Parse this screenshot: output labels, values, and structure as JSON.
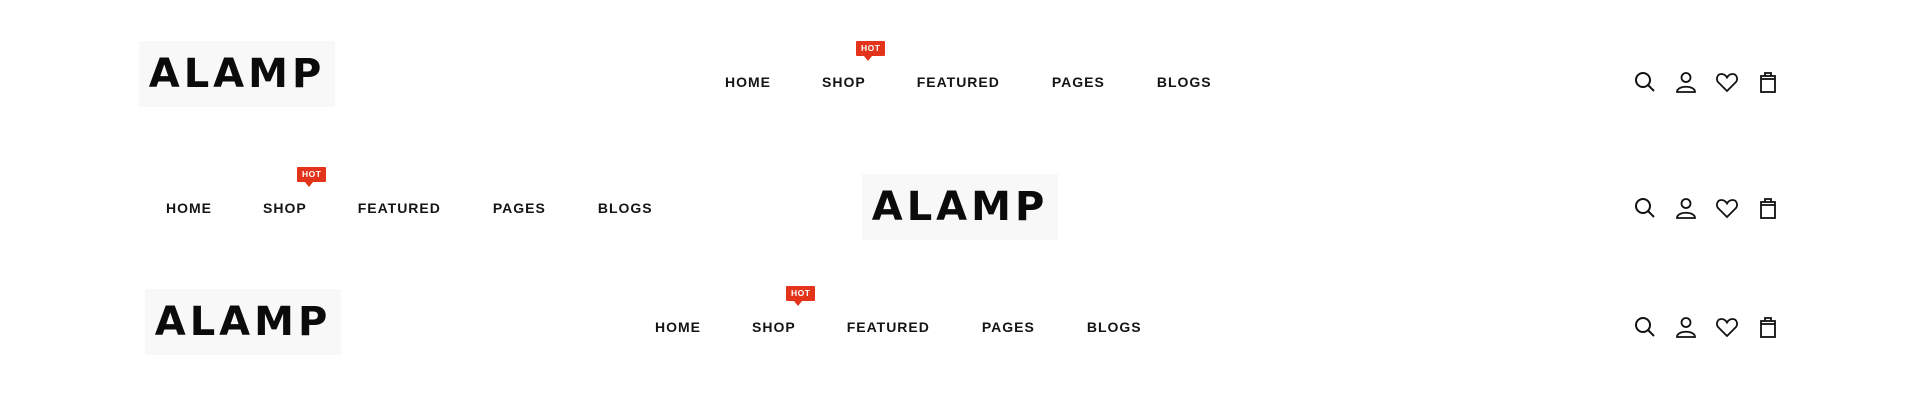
{
  "headers": [
    {
      "logo": "ALAMP",
      "nav": [
        {
          "label": "HOME"
        },
        {
          "label": "SHOP",
          "badge": "HOT"
        },
        {
          "label": "FEATURED"
        },
        {
          "label": "PAGES"
        },
        {
          "label": "BLOGS"
        }
      ],
      "icons": [
        "search-icon",
        "user-icon",
        "heart-icon",
        "shopping-bag-icon"
      ]
    },
    {
      "logo": "ALAMP",
      "nav": [
        {
          "label": "HOME"
        },
        {
          "label": "SHOP",
          "badge": "HOT"
        },
        {
          "label": "FEATURED"
        },
        {
          "label": "PAGES"
        },
        {
          "label": "BLOGS"
        }
      ],
      "icons": [
        "search-icon",
        "user-icon",
        "heart-icon",
        "shopping-bag-icon"
      ]
    },
    {
      "logo": "ALAMP",
      "nav": [
        {
          "label": "HOME"
        },
        {
          "label": "SHOP",
          "badge": "HOT"
        },
        {
          "label": "FEATURED"
        },
        {
          "label": "PAGES"
        },
        {
          "label": "BLOGS"
        }
      ],
      "icons": [
        "search-icon",
        "user-icon",
        "heart-icon",
        "shopping-bag-icon"
      ]
    }
  ],
  "colors": {
    "accent": "#e3341b",
    "text": "#141414",
    "logo_bg": "#f8f8f8"
  }
}
